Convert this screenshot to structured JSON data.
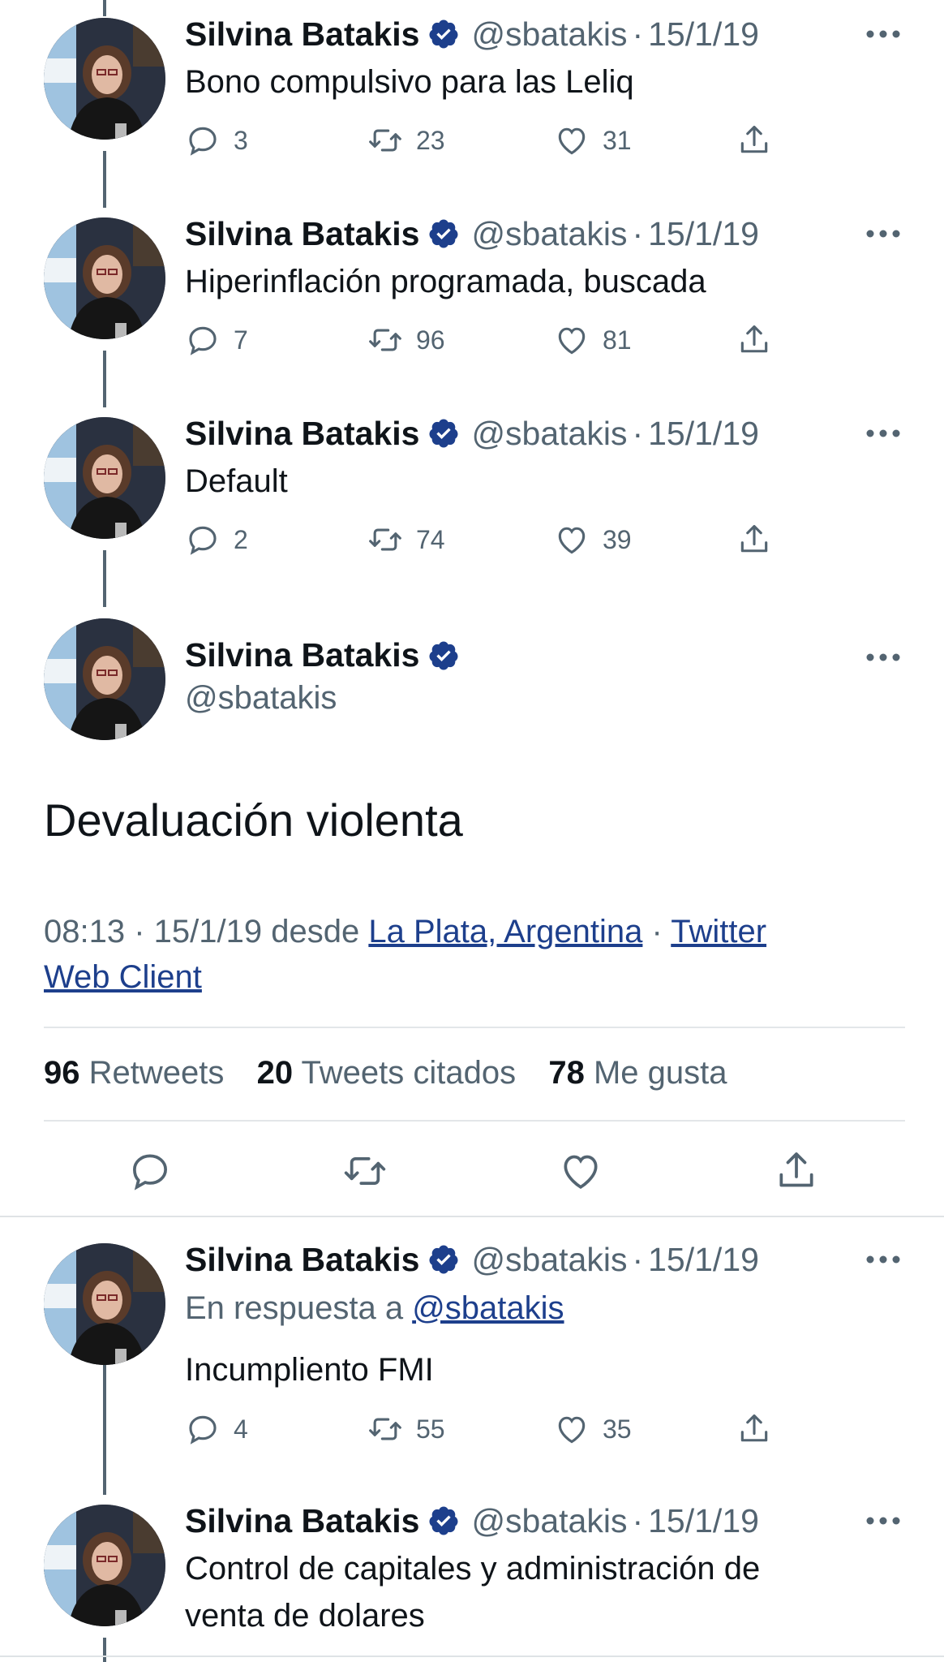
{
  "author": {
    "name": "Silvina Batakis",
    "handle": "@sbatakis"
  },
  "tweets_before": [
    {
      "date": "15/1/19",
      "text": "Bono compulsivo para las Leliq",
      "replies": "3",
      "retweets": "23",
      "likes": "31"
    },
    {
      "date": "15/1/19",
      "text": "Hiperinflación programada, buscada",
      "replies": "7",
      "retweets": "96",
      "likes": "81"
    },
    {
      "date": "15/1/19",
      "text": "Default",
      "replies": "2",
      "retweets": "74",
      "likes": "39"
    }
  ],
  "main_tweet": {
    "text": "Devaluación violenta",
    "time": "08:13",
    "date": "15/1/19",
    "from_label": "desde",
    "location": "La Plata, Argentina",
    "client_line1": "Twitter",
    "client_line2": "Web Client",
    "stats": {
      "retweets": "96",
      "retweets_label": "Retweets",
      "quotes": "20",
      "quotes_label": "Tweets citados",
      "likes": "78",
      "likes_label": "Me gusta"
    }
  },
  "tweets_after": [
    {
      "date": "15/1/19",
      "reply_prefix": "En respuesta a",
      "reply_handle": "@sbatakis",
      "text": "Incumpliento FMI",
      "replies": "4",
      "retweets": "55",
      "likes": "35"
    },
    {
      "date": "15/1/19",
      "text_line1": "Control de capitales y administración de",
      "text_line2": "venta de dolares"
    }
  ],
  "icons": [
    "verified-badge-icon",
    "more-options-icon",
    "reply-icon",
    "retweet-icon",
    "like-icon",
    "share-icon"
  ],
  "colors": {
    "verified": "#1d3f8c",
    "secondary_text": "#536471",
    "link": "#1d3f8c"
  }
}
